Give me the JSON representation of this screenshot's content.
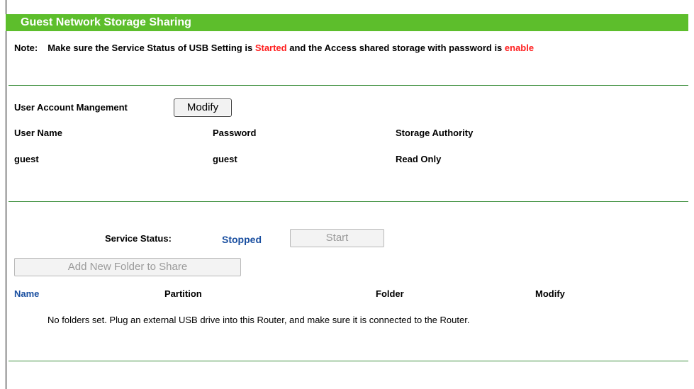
{
  "header": {
    "title": "Guest Network Storage Sharing"
  },
  "note": {
    "label": "Note:",
    "part1": "Make sure the Service Status of USB Setting is ",
    "started": "Started",
    "part2": " and the Access shared storage with password is ",
    "enable": "enable"
  },
  "accounts": {
    "section_label": "User Account Mangement",
    "modify_button": "Modify",
    "columns": [
      "User Name",
      "Password",
      "Storage Authority"
    ],
    "rows": [
      {
        "user_name": "guest",
        "password": "guest",
        "authority": "Read Only"
      }
    ]
  },
  "service": {
    "status_label": "Service Status:",
    "status_value": "Stopped",
    "start_button": "Start",
    "add_folder_button": "Add New Folder to Share"
  },
  "folders": {
    "columns": [
      "Name",
      "Partition",
      "Folder",
      "Modify"
    ],
    "empty_message": "No folders set. Plug an external USB drive into this Router, and make sure it is connected to the Router."
  },
  "colors": {
    "title_bar": "#5dbe2c",
    "divider": "#3e8f3e",
    "highlight_red": "#ff2020",
    "link_blue": "#1a4fa0"
  }
}
